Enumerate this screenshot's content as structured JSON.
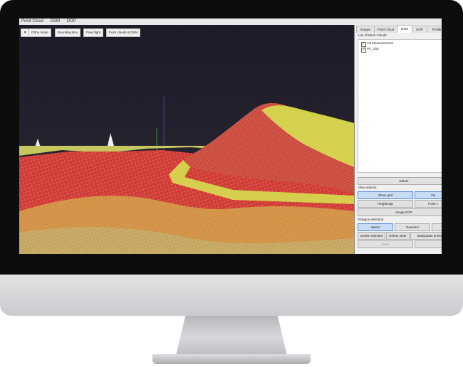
{
  "menubar": {
    "items": [
      "Point Cloud",
      "DSM",
      "DOP"
    ]
  },
  "viewport": {
    "buttons": [
      "Ortho mode",
      "Bounding Box",
      "Free flight",
      "Point clouds & DSM"
    ]
  },
  "panel": {
    "tabs": [
      "Images",
      "Point Cloud",
      "DSM",
      "DOP",
      "Profile"
    ],
    "active_tab": "DSM",
    "list_label": "List of Mesh Clouds:",
    "mesh_clouds": [
      {
        "name": "1st Measurements",
        "checked": true
      },
      {
        "name": "PC_Clip",
        "checked": true
      }
    ],
    "delete_label": "Delete",
    "view_options_label": "View options:",
    "show_grid_label": "Show grid",
    "view_right_label": "Vie",
    "heightmap_label": "Heightmap",
    "point_label": "Point c",
    "image_dop_label": "Image DOP",
    "polygon_label": "Polygon selection:",
    "select_label": "Select",
    "deselect_label": "Deselect",
    "delete_selected_label": "Delete selected",
    "delete_other_label": "Delete other",
    "manipulate_label": "Manipulate points ▾",
    "save_label": "Save"
  },
  "colors": {
    "terrain_red": "#d93a3a",
    "terrain_yellow": "#d8d84a",
    "sky": "#23202e"
  }
}
